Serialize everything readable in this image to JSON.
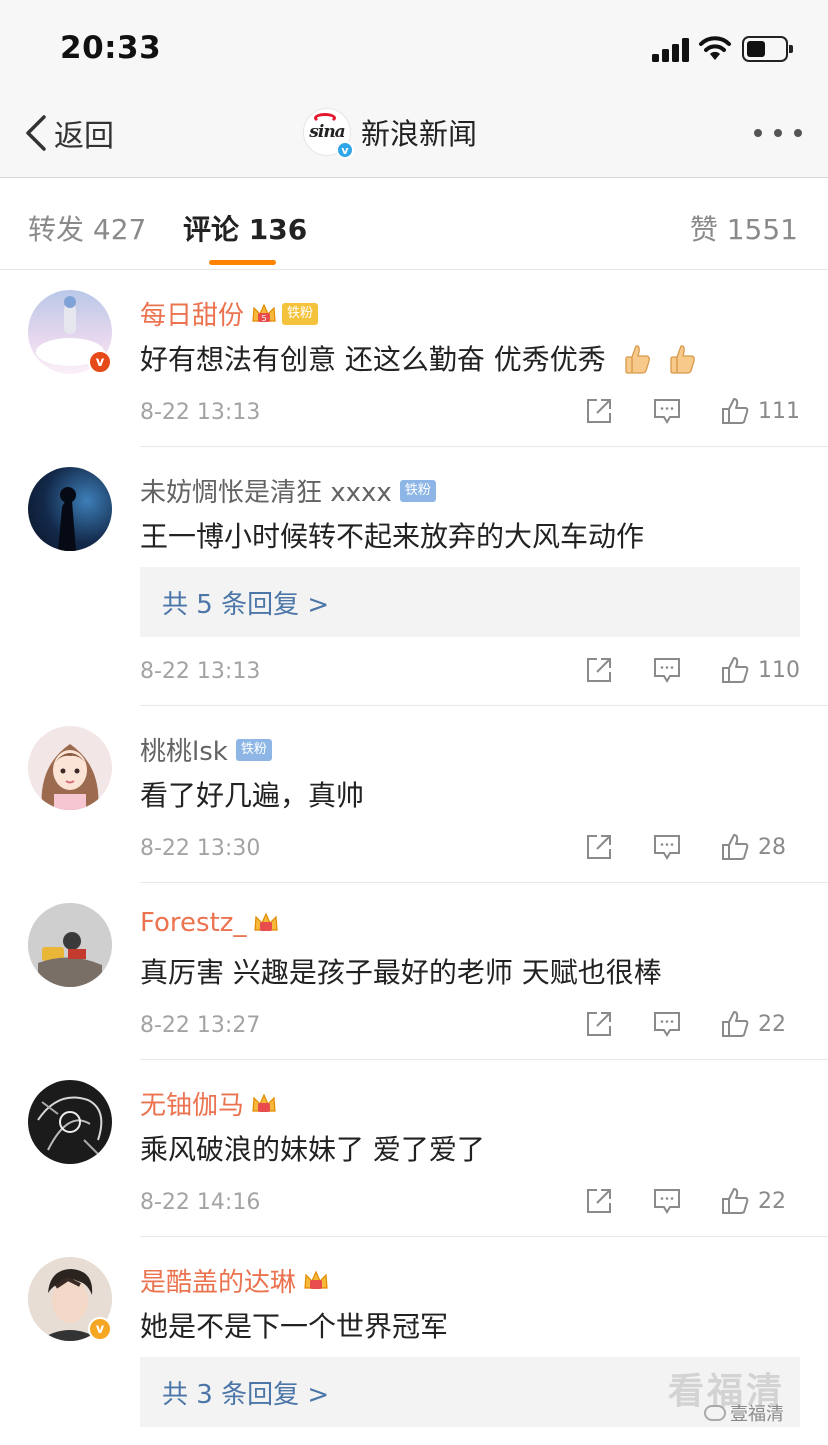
{
  "status": {
    "time": "20:33"
  },
  "nav": {
    "back_label": "返回",
    "title": "新浪新闻",
    "logo_text": "sina"
  },
  "tabs": {
    "repost": "转发 427",
    "comment": "评论 136",
    "like": "赞 1551"
  },
  "comments": [
    {
      "user": "每日甜份",
      "badge": "铁粉",
      "text": "好有想法有创意 还这么勤奋  优秀优秀",
      "time": "8-22 13:13",
      "likes": "111"
    },
    {
      "user": "未妨惆怅是清狂 xxxx",
      "badge": "铁粉",
      "text": "王一博小时候转不起来放弃的大风车动作",
      "replies": "共 5 条回复 >",
      "time": "8-22 13:13",
      "likes": "110"
    },
    {
      "user": "桃桃lsk",
      "badge": "铁粉",
      "text": "看了好几遍，真帅",
      "time": "8-22 13:30",
      "likes": "28"
    },
    {
      "user": "Forestz_",
      "text": "真厉害 兴趣是孩子最好的老师  天赋也很棒",
      "time": "8-22 13:27",
      "likes": "22"
    },
    {
      "user": "无铀伽马",
      "text": "乘风破浪的妹妹了 爱了爱了",
      "time": "8-22 14:16",
      "likes": "22"
    },
    {
      "user": "是酷盖的达琳",
      "text": "她是不是下一个世界冠军",
      "replies": "共 3 条回复 >"
    }
  ],
  "watermark": {
    "main": "看福清",
    "sub": "壹福清"
  },
  "colors": {
    "accent": "#ff8200",
    "username": "#eb7350",
    "link": "#4d76a8"
  }
}
